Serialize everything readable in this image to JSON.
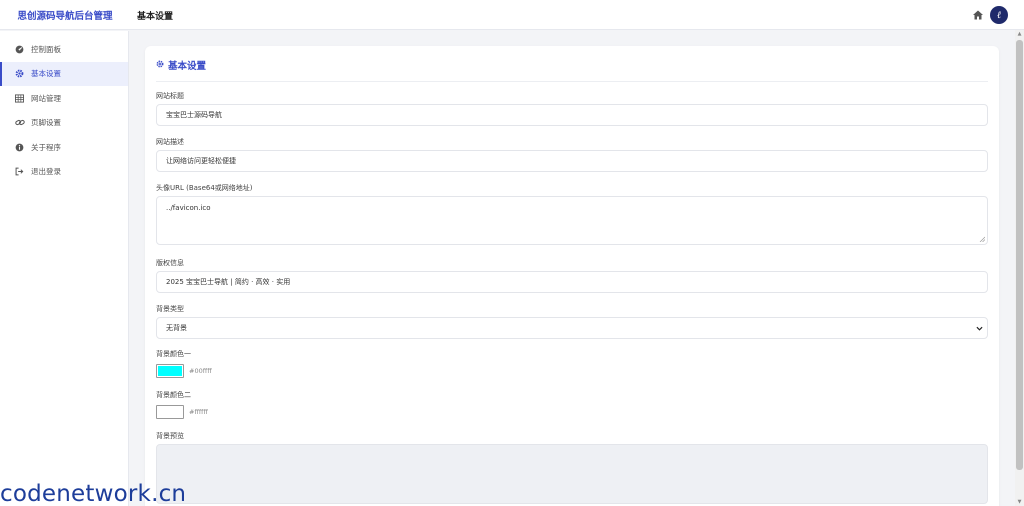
{
  "brand": {
    "title": "思创源码导航后台管理"
  },
  "header": {
    "page_title": "基本设置",
    "avatar_text": "ℓ"
  },
  "sidebar": {
    "items": [
      {
        "label": "控制面板",
        "icon": "dashboard-icon",
        "active": false
      },
      {
        "label": "基本设置",
        "icon": "gear-icon",
        "active": true
      },
      {
        "label": "网站管理",
        "icon": "grid-icon",
        "active": false
      },
      {
        "label": "页脚设置",
        "icon": "link-icon",
        "active": false
      },
      {
        "label": "关于程序",
        "icon": "info-icon",
        "active": false
      },
      {
        "label": "退出登录",
        "icon": "logout-icon",
        "active": false
      }
    ]
  },
  "form": {
    "heading": "基本设置",
    "site_title": {
      "label": "网站标题",
      "value": "宝宝巴士源码导航"
    },
    "site_desc": {
      "label": "网站描述",
      "value": "让网络访问更轻松便捷"
    },
    "avatar_url": {
      "label": "头像URL (Base64或网络地址)",
      "value": "../favicon.ico"
    },
    "copyright": {
      "label": "版权信息",
      "value": "2025 宝宝巴士导航 | 简约 · 高效 · 实用"
    },
    "bg_type": {
      "label": "背景类型",
      "value": "无背景"
    },
    "bg_color1": {
      "label": "背景颜色一",
      "value": "#00ffff"
    },
    "bg_color2": {
      "label": "背景颜色二",
      "value": "#ffffff"
    },
    "bg_preview": {
      "label": "背景预览"
    }
  },
  "colors": {
    "accent": "#3a4cc8",
    "color1": "#00ffff",
    "color2": "#ffffff"
  },
  "watermark": "codenetwork.cn"
}
